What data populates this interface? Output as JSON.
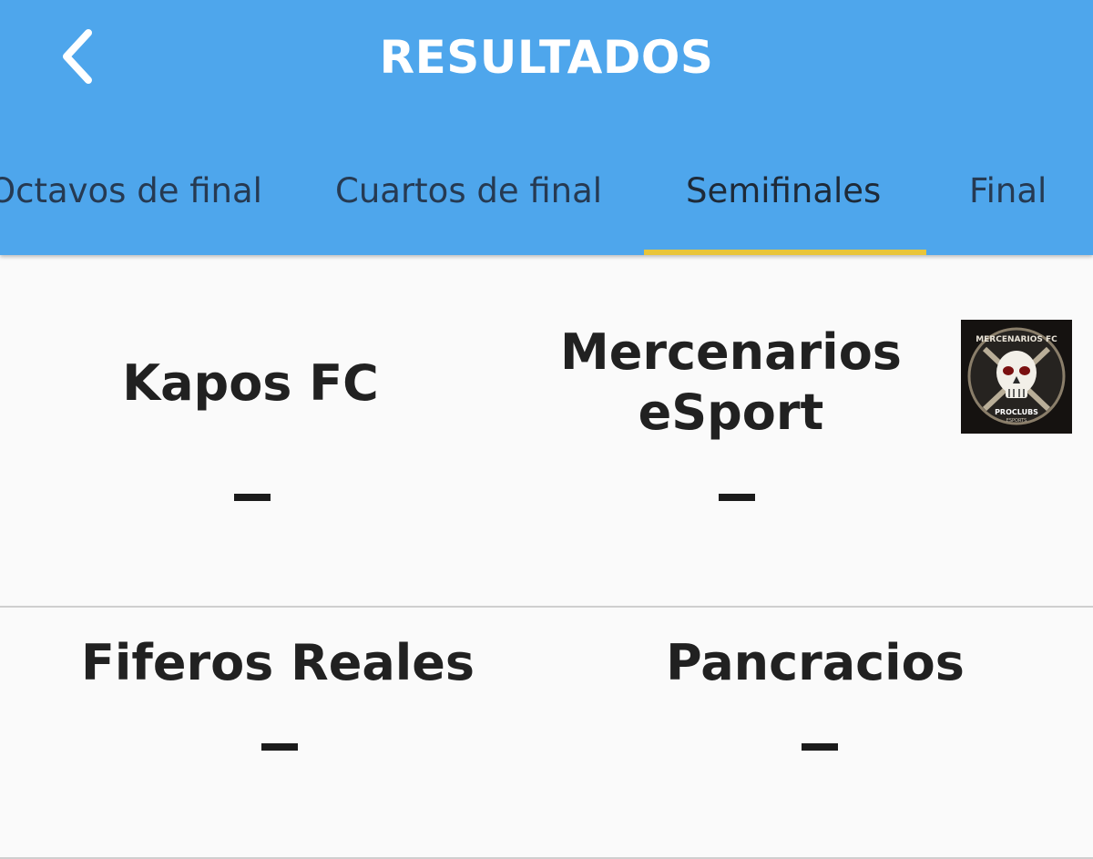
{
  "header": {
    "title": "RESULTADOS",
    "back_icon": "chevron-left-icon",
    "background_color": "#4ea6ec",
    "title_color": "#ffffff"
  },
  "tabs": [
    {
      "label": "Octavos de final",
      "selected": false
    },
    {
      "label": "Cuartos de final",
      "selected": false
    },
    {
      "label": "Semifinales",
      "selected": true
    },
    {
      "label": "Final",
      "selected": false
    }
  ],
  "tab_indicator_color": "#e9c53a",
  "matches": [
    {
      "home": {
        "name": "Kapos FC",
        "score": "-"
      },
      "away": {
        "name": "Mercenarios eSport",
        "score": "-",
        "logo_text": "MERCENARIOS FC",
        "logo_subtext": "PROCLUBS",
        "logo_subtext2": "ESPORTS"
      }
    },
    {
      "home": {
        "name": "Fiferos Reales",
        "score": "-"
      },
      "away": {
        "name": "Pancracios",
        "score": "-"
      }
    }
  ]
}
